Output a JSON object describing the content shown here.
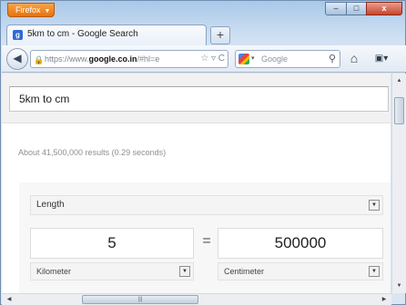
{
  "browser": {
    "app_button_label": "Firefox",
    "window_controls": {
      "minimize": "–",
      "maximize": "□",
      "close": "x"
    }
  },
  "tab": {
    "title": "5km to cm - Google Search",
    "favicon": "google-favicon-icon"
  },
  "navbar": {
    "url_prefix": "https://www.",
    "url_domain": "google.co.in",
    "url_rest": "/#hl=e",
    "url_tail": "☆ ▿ C",
    "search_engine_label": "Google",
    "search_icon": "search-icon",
    "home_icon": "home-icon",
    "menu_icon": "bookmarks-menu-icon"
  },
  "search": {
    "query": "5km to cm"
  },
  "results": {
    "stats": "About 41,500,000 results (0.29 seconds)"
  },
  "converter": {
    "category": "Length",
    "from_value": "5",
    "to_value": "500000",
    "equals": "=",
    "from_unit": "Kilometer",
    "to_unit": "Centimeter"
  }
}
